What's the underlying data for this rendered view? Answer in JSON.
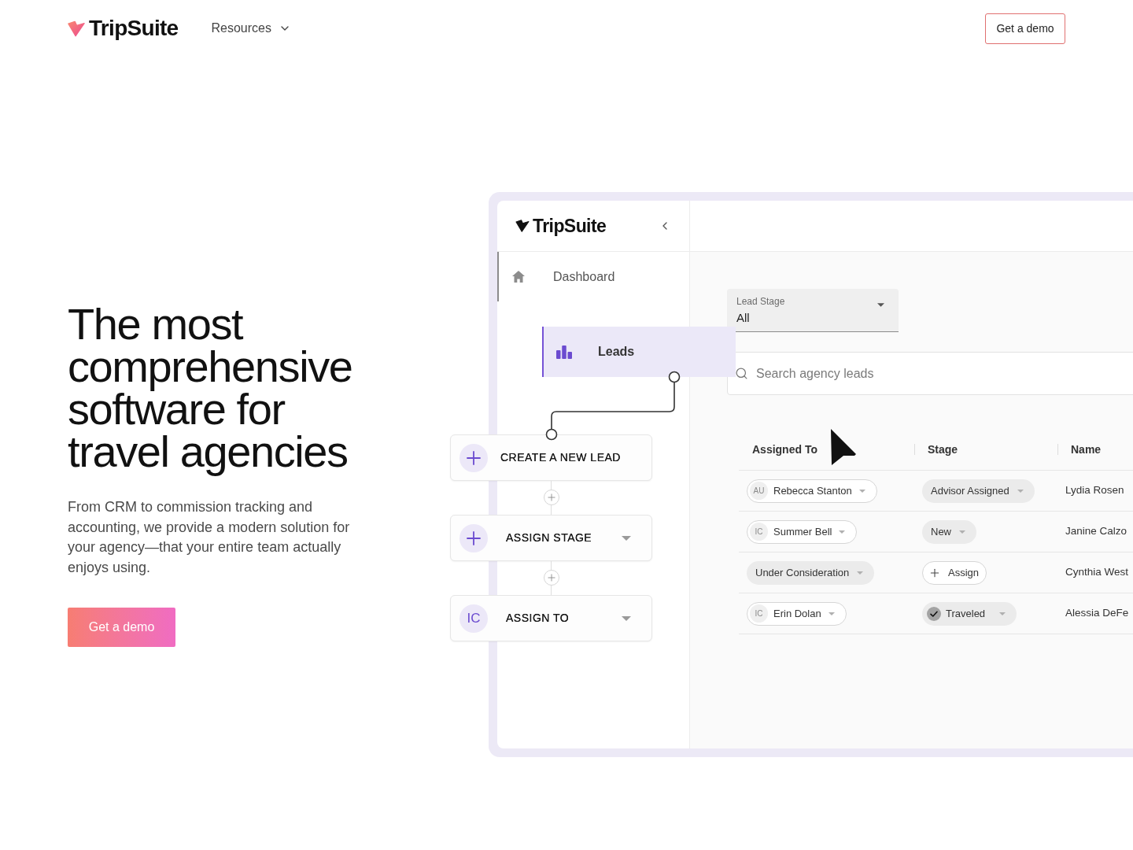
{
  "header": {
    "logo": {
      "text": "TripSuite"
    },
    "nav": [
      {
        "label": "Resources",
        "dropdown": true
      }
    ],
    "cta": {
      "label": "Get a demo"
    }
  },
  "hero": {
    "heading": "The most comprehensive software for travel agencies",
    "description": "From CRM to commission tracking and accounting, we provide a modern solution for your agency—that your entire team actually enjoys using.",
    "cta": {
      "label": "Get a demo"
    }
  },
  "app_preview": {
    "sidebar": {
      "logo": {
        "text": "TripSuite"
      },
      "items": [
        {
          "label": "Dashboard",
          "selected": false
        },
        {
          "label": "Leads",
          "selected": true
        }
      ]
    },
    "workflow": [
      {
        "label": "CREATE A NEW LEAD",
        "dropdown": false
      },
      {
        "label": "ASSIGN STAGE",
        "dropdown": true
      },
      {
        "label": "ASSIGN TO",
        "initials": "IC",
        "dropdown": true
      }
    ],
    "filter": {
      "label": "Lead Stage",
      "value": "All"
    },
    "search": {
      "placeholder": "Search agency leads"
    },
    "table": {
      "columns": [
        "Assigned To",
        "Stage",
        "Name"
      ],
      "rows": [
        {
          "cells": [
            {
              "kind": "person",
              "initials": "AU",
              "label": "Rebecca Stanton"
            },
            {
              "kind": "status",
              "label": "Advisor Assigned",
              "done": false
            },
            {
              "kind": "text",
              "label": "Lydia Rosen"
            }
          ]
        },
        {
          "cells": [
            {
              "kind": "person",
              "initials": "IC",
              "label": "Summer Bell"
            },
            {
              "kind": "status",
              "label": "New",
              "done": false
            },
            {
              "kind": "text",
              "label": "Janine Calzo"
            }
          ]
        },
        {
          "cells": [
            {
              "kind": "status",
              "label": "Under Consideration",
              "done": false
            },
            {
              "kind": "action",
              "label": "Assign"
            },
            {
              "kind": "text",
              "label": "Cynthia West"
            }
          ]
        },
        {
          "cells": [
            {
              "kind": "person",
              "initials": "IC",
              "label": "Erin Dolan"
            },
            {
              "kind": "status",
              "label": "Traveled",
              "done": true
            },
            {
              "kind": "text",
              "label": "Alessia DeFe"
            }
          ]
        }
      ]
    }
  }
}
